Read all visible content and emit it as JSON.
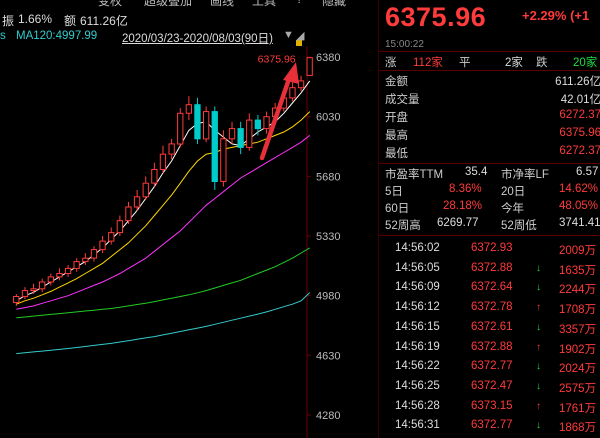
{
  "toolbar": {
    "items": [
      "变权",
      "超级叠加",
      "画线",
      "工具",
      "?",
      "隐藏"
    ]
  },
  "chart_info": {
    "amplitude_label": "振",
    "amplitude_value": "1.66%",
    "amount_label": "额",
    "amount_value": "611.26亿",
    "ma_label": "MA120:4997.99",
    "date_range": "2020/03/23-2020/08/03(90日)"
  },
  "chart_data": {
    "type": "candlestick",
    "y_ticks": [
      "6380",
      "6030",
      "5680",
      "5330",
      "4980",
      "4630",
      "4280"
    ],
    "ylim": [
      4280,
      6380
    ],
    "last_price_label": "6375.96",
    "candles": [
      {
        "o": 4940,
        "c": 4975,
        "h": 4990,
        "l": 4920
      },
      {
        "o": 4975,
        "c": 5010,
        "h": 5030,
        "l": 4960
      },
      {
        "o": 5010,
        "c": 5020,
        "h": 5050,
        "l": 4990
      },
      {
        "o": 5020,
        "c": 5060,
        "h": 5080,
        "l": 5000
      },
      {
        "o": 5060,
        "c": 5090,
        "h": 5110,
        "l": 5040
      },
      {
        "o": 5090,
        "c": 5110,
        "h": 5140,
        "l": 5070
      },
      {
        "o": 5110,
        "c": 5140,
        "h": 5160,
        "l": 5090
      },
      {
        "o": 5140,
        "c": 5180,
        "h": 5200,
        "l": 5120
      },
      {
        "o": 5180,
        "c": 5200,
        "h": 5230,
        "l": 5160
      },
      {
        "o": 5200,
        "c": 5250,
        "h": 5270,
        "l": 5180
      },
      {
        "o": 5250,
        "c": 5300,
        "h": 5330,
        "l": 5230
      },
      {
        "o": 5300,
        "c": 5350,
        "h": 5380,
        "l": 5280
      },
      {
        "o": 5350,
        "c": 5420,
        "h": 5450,
        "l": 5330
      },
      {
        "o": 5420,
        "c": 5500,
        "h": 5530,
        "l": 5400
      },
      {
        "o": 5500,
        "c": 5560,
        "h": 5600,
        "l": 5480
      },
      {
        "o": 5560,
        "c": 5640,
        "h": 5680,
        "l": 5540
      },
      {
        "o": 5640,
        "c": 5720,
        "h": 5760,
        "l": 5620
      },
      {
        "o": 5720,
        "c": 5810,
        "h": 5860,
        "l": 5700
      },
      {
        "o": 5810,
        "c": 5870,
        "h": 5900,
        "l": 5780
      },
      {
        "o": 5870,
        "c": 6050,
        "h": 6080,
        "l": 5850
      },
      {
        "o": 6050,
        "c": 6100,
        "h": 6150,
        "l": 6010
      },
      {
        "o": 6100,
        "c": 5900,
        "h": 6140,
        "l": 5870
      },
      {
        "o": 5900,
        "c": 6060,
        "h": 6090,
        "l": 5880
      },
      {
        "o": 6060,
        "c": 5650,
        "h": 6090,
        "l": 5600
      },
      {
        "o": 5650,
        "c": 5900,
        "h": 5950,
        "l": 5620
      },
      {
        "o": 5900,
        "c": 5960,
        "h": 6000,
        "l": 5870
      },
      {
        "o": 5960,
        "c": 5850,
        "h": 6000,
        "l": 5810
      },
      {
        "o": 5850,
        "c": 6010,
        "h": 6050,
        "l": 5830
      },
      {
        "o": 6010,
        "c": 5960,
        "h": 6040,
        "l": 5920
      },
      {
        "o": 5960,
        "c": 6030,
        "h": 6060,
        "l": 5930
      },
      {
        "o": 6030,
        "c": 6080,
        "h": 6110,
        "l": 6000
      },
      {
        "o": 6080,
        "c": 6140,
        "h": 6190,
        "l": 6060
      },
      {
        "o": 6140,
        "c": 6200,
        "h": 6240,
        "l": 6120
      },
      {
        "o": 6200,
        "c": 6240,
        "h": 6270,
        "l": 6180
      },
      {
        "o": 6272.37,
        "c": 6375.96,
        "h": 6375.96,
        "l": 6272.37
      }
    ],
    "ma_lines": [
      {
        "name": "MA5",
        "color": "#ffffff"
      },
      {
        "name": "MA10",
        "color": "#ffd700"
      },
      {
        "name": "MA20",
        "color": "#ff33ff"
      },
      {
        "name": "MA60",
        "color": "#22cc22"
      },
      {
        "name": "MA120",
        "color": "#33cccc"
      }
    ],
    "ma_values": {
      "MA5": [
        4950,
        4980,
        5000,
        5030,
        5060,
        5090,
        5120,
        5150,
        5180,
        5220,
        5260,
        5310,
        5360,
        5420,
        5480,
        5550,
        5620,
        5700,
        5770,
        5860,
        5950,
        5990,
        6000,
        5950,
        5910,
        5870,
        5860,
        5900,
        5940,
        5970,
        6000,
        6050,
        6110,
        6170,
        6240
      ],
      "MA10": [
        4930,
        4950,
        4965,
        4985,
        5005,
        5030,
        5055,
        5080,
        5110,
        5140,
        5170,
        5210,
        5250,
        5290,
        5340,
        5390,
        5450,
        5510,
        5570,
        5640,
        5710,
        5770,
        5810,
        5820,
        5840,
        5850,
        5860,
        5870,
        5880,
        5900,
        5920,
        5940,
        5970,
        6010,
        6060
      ],
      "MA20": [
        4900,
        4910,
        4920,
        4935,
        4950,
        4965,
        4980,
        5000,
        5020,
        5040,
        5060,
        5085,
        5110,
        5140,
        5170,
        5200,
        5240,
        5280,
        5320,
        5360,
        5410,
        5460,
        5510,
        5550,
        5590,
        5630,
        5670,
        5700,
        5730,
        5760,
        5790,
        5820,
        5850,
        5880,
        5920
      ],
      "MA60": [
        4850,
        4855,
        4860,
        4865,
        4870,
        4875,
        4880,
        4885,
        4890,
        4895,
        4900,
        4905,
        4912,
        4920,
        4928,
        4936,
        4945,
        4955,
        4965,
        4975,
        4985,
        4997,
        5010,
        5025,
        5040,
        5055,
        5070,
        5090,
        5110,
        5130,
        5150,
        5175,
        5200,
        5230,
        5260
      ],
      "MA120": [
        4640,
        4645,
        4650,
        4655,
        4660,
        4665,
        4670,
        4676,
        4682,
        4688,
        4694,
        4700,
        4708,
        4716,
        4724,
        4732,
        4740,
        4750,
        4760,
        4770,
        4780,
        4790,
        4800,
        4812,
        4824,
        4836,
        4848,
        4860,
        4872,
        4885,
        4900,
        4915,
        4930,
        4950,
        4997.99
      ]
    }
  },
  "quote": {
    "price": "6375.96",
    "change": "+2.29% (+1",
    "time": "15:00:22",
    "up_label": "涨",
    "up_count": "112家",
    "flat_label": "平",
    "flat_count": "2家",
    "down_label": "跌",
    "down_count": "20家",
    "rows": [
      {
        "label": "金额",
        "value": "611.26亿",
        "color": "white"
      },
      {
        "label": "成交量",
        "value": "42.01亿",
        "color": "white"
      },
      {
        "label": "开盘",
        "value": "6272.37",
        "color": "red"
      },
      {
        "label": "最高",
        "value": "6375.96",
        "color": "red"
      },
      {
        "label": "最低",
        "value": "6272.37",
        "color": "red"
      }
    ],
    "pe_label": "市盈率TTM",
    "pe_value": "35.4",
    "pb_label": "市净率LF",
    "pb_value": "6.57",
    "d5_label": "5日",
    "d5_value": "8.36%",
    "d20_label": "20日",
    "d20_value": "14.62%",
    "d60_label": "60日",
    "d60_value": "28.18%",
    "ytd_label": "今年",
    "ytd_value": "48.05%",
    "w52h_label": "52周高",
    "w52h_value": "6269.77",
    "w52l_label": "52周低",
    "w52l_value": "3741.41"
  },
  "trades": [
    {
      "time": "14:56:02",
      "price": "6372.93",
      "arrow": "",
      "vol": "2009万"
    },
    {
      "time": "14:56:05",
      "price": "6372.88",
      "arrow": "↓",
      "vol": "1635万"
    },
    {
      "time": "14:56:09",
      "price": "6372.64",
      "arrow": "↓",
      "vol": "2244万"
    },
    {
      "time": "14:56:12",
      "price": "6372.78",
      "arrow": "↑",
      "vol": "1708万"
    },
    {
      "time": "14:56:15",
      "price": "6372.61",
      "arrow": "↓",
      "vol": "3357万"
    },
    {
      "time": "14:56:19",
      "price": "6372.88",
      "arrow": "↑",
      "vol": "1902万"
    },
    {
      "time": "14:56:22",
      "price": "6372.77",
      "arrow": "↓",
      "vol": "2024万"
    },
    {
      "time": "14:56:25",
      "price": "6372.47",
      "arrow": "↓",
      "vol": "2575万"
    },
    {
      "time": "14:56:28",
      "price": "6373.15",
      "arrow": "↑",
      "vol": "1761万"
    },
    {
      "time": "14:56:31",
      "price": "6372.77",
      "arrow": "↓",
      "vol": "1868万"
    }
  ],
  "colors": {
    "up": "#ff3b3b",
    "down": "#00cccc",
    "green": "#22dd44",
    "annotation_arrow": "#e8303a"
  }
}
